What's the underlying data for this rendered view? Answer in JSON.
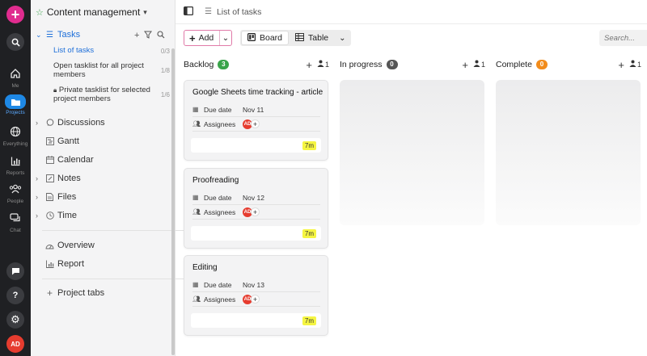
{
  "rail": {
    "items": [
      {
        "icon": "plus-icon",
        "label": ""
      },
      {
        "icon": "search-icon",
        "label": ""
      },
      {
        "icon": "home-icon",
        "label": "Me"
      },
      {
        "icon": "folder-icon",
        "label": "Projects"
      },
      {
        "icon": "globe-icon",
        "label": "Everything"
      },
      {
        "icon": "chart-icon",
        "label": "Reports"
      },
      {
        "icon": "people-icon",
        "label": "People"
      },
      {
        "icon": "chat-icon",
        "label": "Chat"
      }
    ],
    "avatar_initials": "AD"
  },
  "sidebar": {
    "project_title": "Content management",
    "tasks_label": "Tasks",
    "tasklists": [
      {
        "label": "List of tasks",
        "count": "0/3"
      },
      {
        "label": "Open tasklist for all project members",
        "count": "1/8"
      },
      {
        "label": "Private tasklist for selected project members",
        "count": "1/6"
      }
    ],
    "items": [
      {
        "label": "Discussions"
      },
      {
        "label": "Gantt"
      },
      {
        "label": "Calendar"
      },
      {
        "label": "Notes"
      },
      {
        "label": "Files"
      },
      {
        "label": "Time"
      }
    ],
    "overview_label": "Overview",
    "report_label": "Report",
    "project_tabs_label": "Project tabs"
  },
  "topbar": {
    "breadcrumb": "List of tasks"
  },
  "toolbar": {
    "add_label": "Add",
    "board_label": "Board",
    "table_label": "Table",
    "search_placeholder": "Search..."
  },
  "board": {
    "columns": [
      {
        "title": "Backlog",
        "count": "3",
        "badge_color": "#3aa44a",
        "member_count": "1"
      },
      {
        "title": "In progress",
        "count": "0",
        "badge_color": "#555555",
        "member_count": "1"
      },
      {
        "title": "Complete",
        "count": "0",
        "badge_color": "#f28c1c",
        "member_count": "1"
      }
    ],
    "cards": [
      {
        "title": "Google Sheets time tracking - article",
        "due_label": "Due date",
        "due": "Nov 11",
        "assignees_label": "Assignees",
        "assignee": "AD",
        "time": "7m"
      },
      {
        "title": "Proofreading",
        "due_label": "Due date",
        "due": "Nov 12",
        "assignees_label": "Assignees",
        "assignee": "AD",
        "time": "7m"
      },
      {
        "title": "Editing",
        "due_label": "Due date",
        "due": "Nov 13",
        "assignees_label": "Assignees",
        "assignee": "AD",
        "time": "7m"
      }
    ]
  },
  "colors": {
    "accent_pink": "#e02c8f",
    "active_blue": "#1e88e5",
    "tasklist_link": "#1e6fd9",
    "time_highlight": "#f5f542"
  }
}
